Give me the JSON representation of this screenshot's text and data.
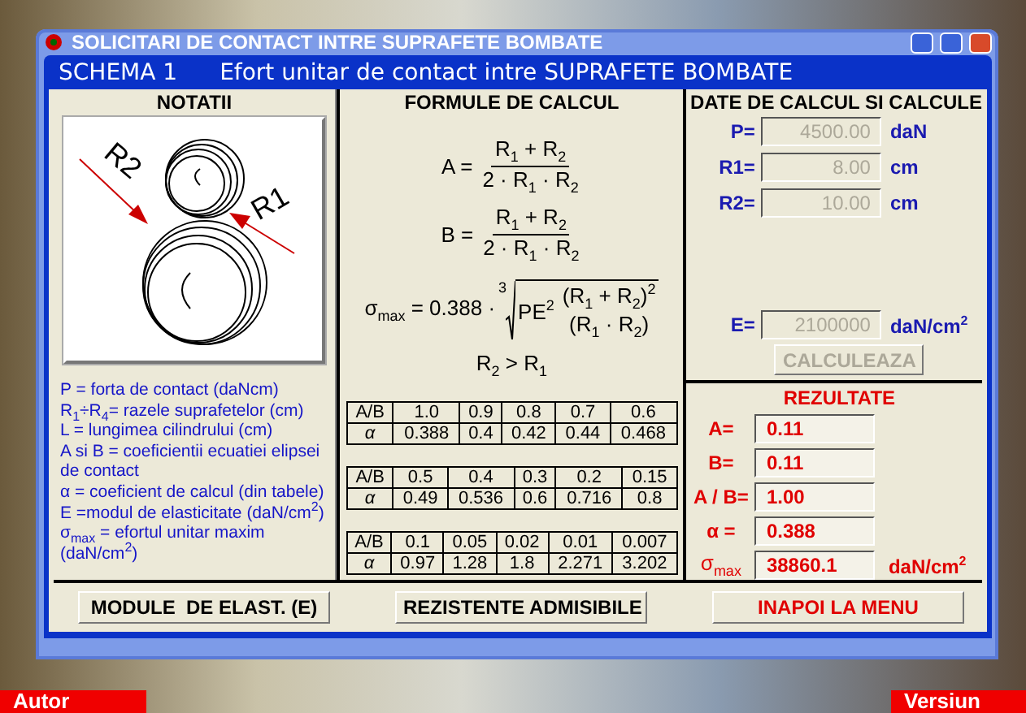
{
  "desktop": {
    "left_tag": "Autor",
    "right_tag": "Versiun"
  },
  "back_window": {
    "title": "SOLICITARI DE CONTACT INTRE SUPRAFETE BOMBATE"
  },
  "window": {
    "schema": "SCHEMA 1",
    "title": "Efort unitar de contact intre SUPRAFETE BOMBATE"
  },
  "notatii": {
    "heading": "NOTATII",
    "diagram_labels": [
      "R2",
      "R1"
    ],
    "lines": [
      "P = forta de contact (daNcm)",
      "R$_{1}$÷R$_{4}$= razele suprafetelor (cm)",
      "L = lungimea cilindrului (cm)",
      "A si B = coeficientii ecuatiei elipsei de contact",
      "α = coeficient de calcul (din tabele)",
      "E =modul de elasticitate (daN/cm$^{2}$)",
      "σ$_{max}$ = efortul unitar maxim (daN/cm$^{2}$)"
    ]
  },
  "formule": {
    "heading": "FORMULE DE CALCUL",
    "fractions": [
      {
        "lhs": "A =",
        "numerator": "R$_{1}$ + R$_{2}$",
        "denominator": "2 · R$_{1}$ · R$_{2}$"
      },
      {
        "lhs": "B =",
        "numerator": "R$_{1}$ + R$_{2}$",
        "denominator": "2 · R$_{1}$ · R$_{2}$"
      }
    ],
    "sigma": {
      "lhs": "σ$_{max}$ = 0.388 ·",
      "root_index": "3",
      "radicand": "PE$^{2}$",
      "numerator": "(R$_{1}$ + R$_{2}$)$^{2}$",
      "denominator": "(R$_{1}$ · R$_{2}$)"
    },
    "condition": "R$_{2}$ > R$_{1}$",
    "tables": [
      {
        "header_label": "A/B",
        "row_label": "α",
        "header": [
          "1.0",
          "0.9",
          "0.8",
          "0.7",
          "0.6"
        ],
        "values": [
          "0.388",
          "0.4",
          "0.42",
          "0.44",
          "0.468"
        ]
      },
      {
        "header_label": "A/B",
        "row_label": "α",
        "header": [
          "0.5",
          "0.4",
          "0.3",
          "0.2",
          "0.15"
        ],
        "values": [
          "0.49",
          "0.536",
          "0.6",
          "0.716",
          "0.8"
        ]
      },
      {
        "header_label": "A/B",
        "row_label": "α",
        "header": [
          "0.1",
          "0.05",
          "0.02",
          "0.01",
          "0.007"
        ],
        "values": [
          "0.97",
          "1.28",
          "1.8",
          "2.271",
          "3.202"
        ]
      }
    ]
  },
  "date": {
    "heading": "DATE DE CALCUL SI CALCULE",
    "inputs": [
      {
        "label": "P=",
        "value": "4500.00",
        "unit": "daN",
        "disabled": true
      },
      {
        "label": "R1=",
        "value": "8.00",
        "unit": "cm",
        "disabled": true
      },
      {
        "label": "R2=",
        "value": "10.00",
        "unit": "cm",
        "disabled": true
      },
      {
        "label": "E=",
        "value": "2100000",
        "unit": "daN/cm$^{2}$",
        "disabled": true
      }
    ],
    "calculate_button": {
      "label": "CALCULEAZA",
      "disabled": true
    }
  },
  "rezultate": {
    "heading": "REZULTATE",
    "rows": [
      {
        "label": "A=",
        "value": "0.11"
      },
      {
        "label": "B=",
        "value": "0.11"
      },
      {
        "label": "A / B=",
        "value": "1.00"
      },
      {
        "label": "α =",
        "value": "0.388"
      },
      {
        "label": "σ$_{max}$",
        "value": "38860.1",
        "unit": "daN/cm$^{2}$"
      }
    ]
  },
  "buttons": [
    {
      "label": "MODULE  DE ELAST. (E)",
      "color": "#000000"
    },
    {
      "label": "REZISTENTE ADMISIBILE",
      "color": "#000000"
    },
    {
      "label": "INAPOI LA MENU",
      "color": "#e00000"
    }
  ]
}
